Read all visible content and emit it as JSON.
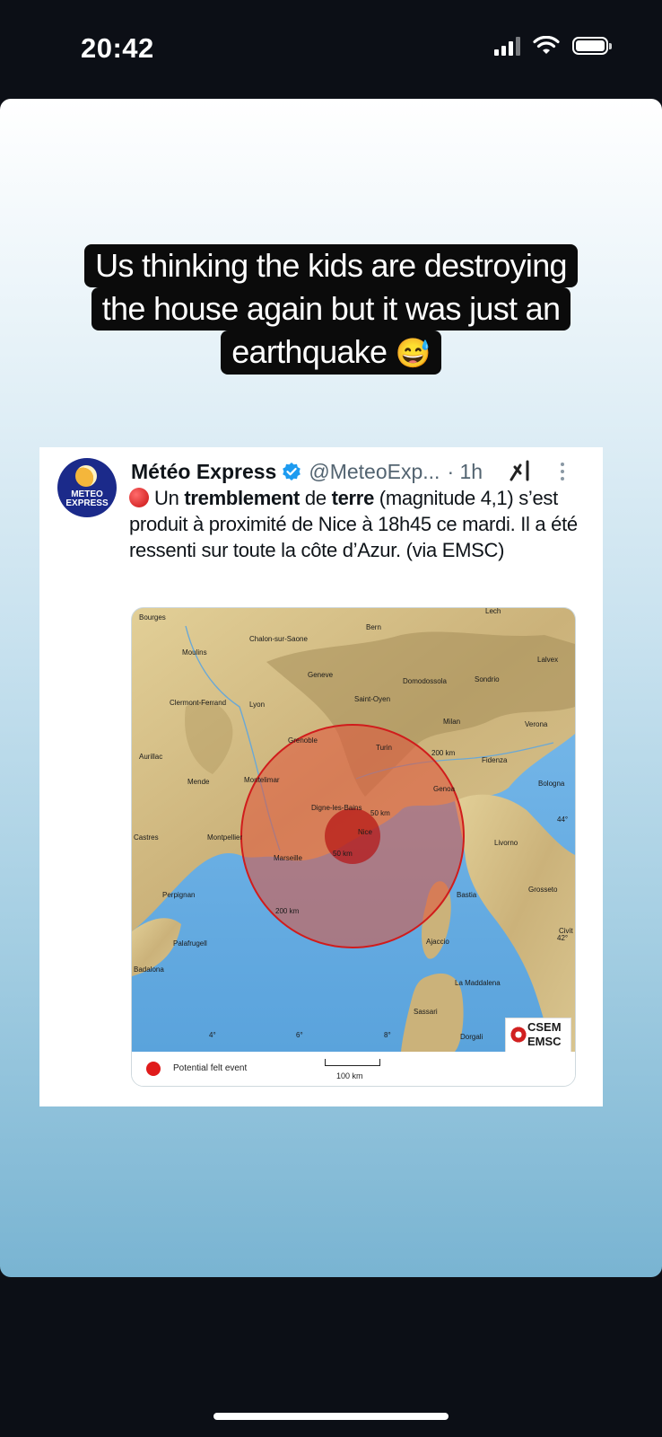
{
  "status_bar": {
    "time": "20:42",
    "battery_level": 1.0
  },
  "story": {
    "caption_lines": [
      "Us thinking the kids are destroying",
      "the house again but it was just an",
      "earthquake"
    ],
    "caption_emoji": "😅"
  },
  "tweet": {
    "avatar_text_line1": "METEO",
    "avatar_text_line2": "EXPRESS",
    "author": "Météo Express",
    "handle": "@MeteoExp...",
    "time": "· 1h",
    "text_segments": {
      "part1": "Un ",
      "bold1": "tremblement",
      "part2": " de ",
      "bold2": "terre",
      "part3": " (magnitude 4,1) s’est produit à proximité de Nice à 18h45 ce mardi. Il a été ressenti sur toute la côte d’Azur. (via EMSC)"
    },
    "map": {
      "cities": {
        "bourges": "Bourges",
        "chalon": "Chalon-sur-Saone",
        "bern": "Bern",
        "lech": "Lech",
        "moulins": "Moulins",
        "geneve": "Geneve",
        "domodossola": "Domodossola",
        "sondrio": "Sondrio",
        "lalvex": "Lalvex",
        "clermont": "Clermont-Ferrand",
        "lyon": "Lyon",
        "saint_oyen": "Saint-Oyen",
        "milan": "Milan",
        "verona": "Verona",
        "grenoble": "Grenoble",
        "turin": "Turin",
        "aurillac": "Aurillac",
        "fidenza": "Fidenza",
        "mende": "Mende",
        "montelimar": "Montelimar",
        "bologna": "Bologna",
        "genoa": "Genoa",
        "digne": "Digne-les-Bains",
        "castres": "Castres",
        "montpellier": "Montpellier",
        "nice": "Nice",
        "livorno": "Livorno",
        "marseille": "Marseille",
        "perpignan": "Perpignan",
        "bastia": "Bastia",
        "grosseto": "Grosseto",
        "palafrugell": "Palafrugell",
        "ajaccio": "Ajaccio",
        "badalona": "Badalona",
        "civit": "Civit",
        "maddalena": "La Maddalena",
        "sassari": "Sassari",
        "dorgali": "Dorgali"
      },
      "rings": {
        "r200_top": "200 km",
        "r200_bottom": "200 km",
        "r50_a": "50 km",
        "r50_b": "50 km"
      },
      "lon_ticks": [
        "4°",
        "6°",
        "8°"
      ],
      "lat_ticks": [
        "44°",
        "42°"
      ],
      "logo_line1": "CSEM",
      "logo_line2": "EMSC",
      "legend": "Potential felt event",
      "scale": "100 km"
    }
  },
  "colors": {
    "sea": "#6fb2e6",
    "land": "#d6c38e",
    "felt_zone": "#e0523a",
    "story_gradient_top": "#ffffff",
    "story_gradient_bottom": "#79b4d2",
    "verified": "#1d9bf0"
  }
}
